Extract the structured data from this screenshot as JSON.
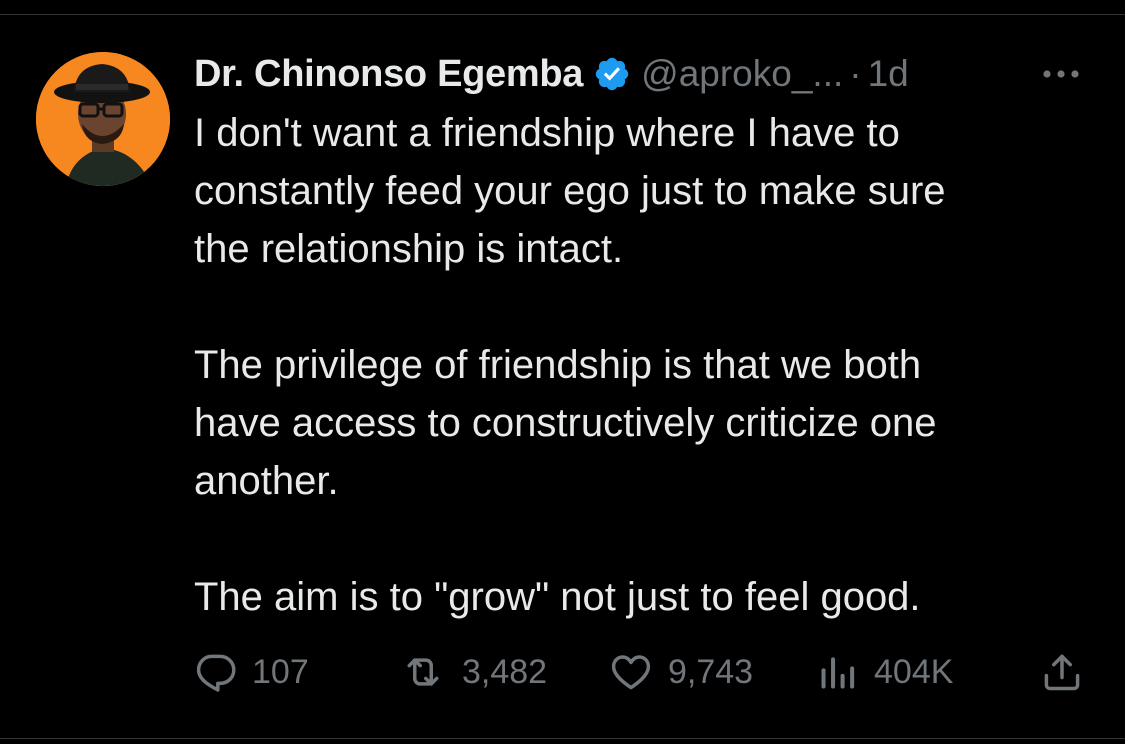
{
  "tweet": {
    "display_name": "Dr. Chinonso Egemba",
    "handle": "@aproko_...",
    "separator": "·",
    "time": "1d",
    "text": "I don't want a friendship where I have to\nconstantly feed your ego just to make sure\nthe relationship is intact.\n\nThe privilege of friendship is that we both\nhave access to constructively criticize one\nanother.\n\nThe aim is to \"grow\" not just to feel good.",
    "verified": true,
    "avatar_icon": "profile-photo-orange-background"
  },
  "actions": {
    "reply": {
      "icon": "reply-icon",
      "count": "107"
    },
    "retweet": {
      "icon": "retweet-icon",
      "count": "3,482"
    },
    "like": {
      "icon": "heart-icon",
      "count": "9,743"
    },
    "views": {
      "icon": "analytics-icon",
      "count": "404K"
    },
    "share": {
      "icon": "share-icon"
    }
  },
  "colors": {
    "background": "#000000",
    "text_primary": "#e7e9ea",
    "text_secondary": "#71767b",
    "verified_blue": "#1d9bf0",
    "avatar_bg": "#f7871f"
  }
}
